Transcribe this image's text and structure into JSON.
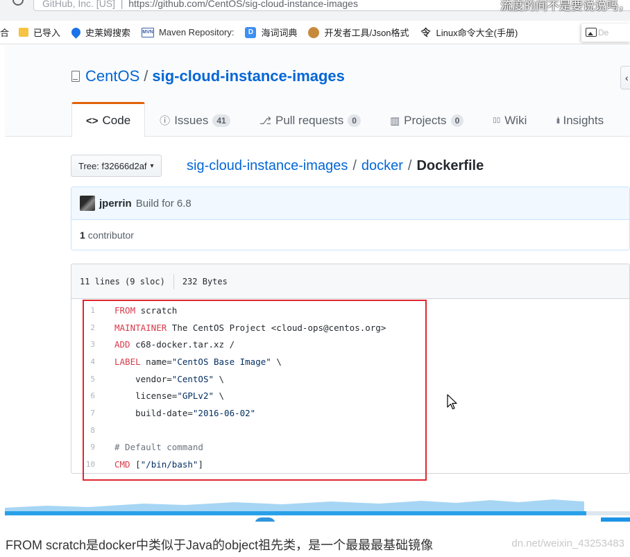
{
  "browser": {
    "url_prefix": "GitHub, Inc. [US]",
    "url_path": "https://github.com/CentOS/sig-cloud-instance-images",
    "overlay_caption": "流度的间不是要说说吗，",
    "bookmarks": [
      {
        "label": "合",
        "icon": "text-icon"
      },
      {
        "label": "已导入",
        "icon": "folder-icon"
      },
      {
        "label": "史莱姆搜索",
        "icon": "drop-icon"
      },
      {
        "label": "Maven Repository:",
        "icon": "mvn-icon"
      },
      {
        "label": "海词词典",
        "icon": "dict-icon"
      },
      {
        "label": "开发者工具/Json格式",
        "icon": "monkey-icon"
      },
      {
        "label": "Linux命令大全(手册)",
        "icon": "command-icon"
      }
    ],
    "bookmark_partial_label": "De"
  },
  "repo": {
    "owner": "CentOS",
    "separator": "/",
    "name": "sig-cloud-instance-images"
  },
  "tabs": [
    {
      "label": "Code",
      "icon": "<>",
      "counter": ""
    },
    {
      "label": "Issues",
      "icon": "ⓘ",
      "counter": "41"
    },
    {
      "label": "Pull requests",
      "icon": "⎇",
      "counter": "0"
    },
    {
      "label": "Projects",
      "icon": "▥",
      "counter": "0"
    },
    {
      "label": "Wiki",
      "icon": "▯▯",
      "counter": ""
    },
    {
      "label": "Insights",
      "icon": "📊",
      "counter": ""
    }
  ],
  "branch": {
    "label": "Tree: f32666d2af",
    "caret": "▾"
  },
  "breadcrumb": {
    "root": "sig-cloud-instance-images",
    "sep": "/",
    "dir": "docker",
    "file": "Dockerfile"
  },
  "commit": {
    "author": "jperrin",
    "message": "Build for 6.8",
    "contributors_count": "1",
    "contributors_label": "contributor"
  },
  "file": {
    "lines_info": "11 lines (9 sloc)",
    "size": "232 Bytes",
    "lines": [
      {
        "n": "1",
        "kw": "FROM",
        "rest": " scratch",
        "type": "kw"
      },
      {
        "n": "2",
        "kw": "MAINTAINER",
        "rest": " The CentOS Project <cloud-ops@centos.org>",
        "type": "kw"
      },
      {
        "n": "3",
        "kw": "ADD",
        "rest": " c68-docker.tar.xz /",
        "type": "kw"
      },
      {
        "n": "4",
        "kw": "LABEL",
        "rest": " name=\"CentOS Base Image\" \\",
        "type": "kw"
      },
      {
        "n": "5",
        "kw": "",
        "rest": "    vendor=\"CentOS\" \\",
        "type": "plain"
      },
      {
        "n": "6",
        "kw": "",
        "rest": "    license=\"GPLv2\" \\",
        "type": "plain"
      },
      {
        "n": "7",
        "kw": "",
        "rest": "    build-date=\"2016-06-02\"",
        "type": "plain"
      },
      {
        "n": "8",
        "kw": "",
        "rest": "",
        "type": "plain"
      },
      {
        "n": "9",
        "kw": "",
        "rest": "# Default command",
        "type": "cmt"
      },
      {
        "n": "10",
        "kw": "CMD",
        "rest": " [\"/bin/bash\"]",
        "type": "kw"
      }
    ]
  },
  "player": {
    "progress_fraction": 0.93
  },
  "caption": "FROM scratch是docker中类似于Java的object祖先类，是一个最最最基础镜像",
  "watermark": "dn.net/weixin_43253483",
  "colors": {
    "link": "#0366d6",
    "tab_active_border": "#e36209",
    "keyword": "#d73a49",
    "highlight_box": "#e1252f",
    "progress": "#29a1e8"
  }
}
